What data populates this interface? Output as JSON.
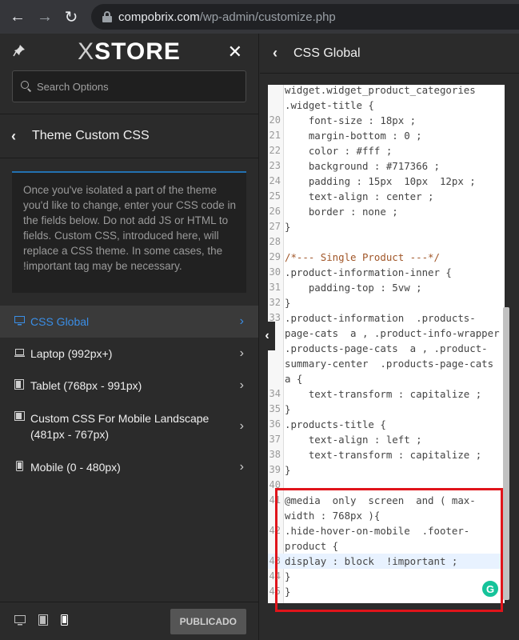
{
  "browser": {
    "url_domain": "compobrix.com",
    "url_path": "/wp-admin/customize.php"
  },
  "sidebar": {
    "logo_x": "X",
    "logo_text": "STORE",
    "search_placeholder": "Search Options",
    "section_title": "Theme Custom CSS",
    "description": "Once you've isolated a part of the theme you'd like to change, enter your CSS code in the fields below. Do not add JS or HTML to fields. Custom CSS, introduced here, will replace a CSS theme. In some cases, the !important tag may be necessary.",
    "items": [
      {
        "label": "CSS Global",
        "icon": "desktop-icon",
        "active": true
      },
      {
        "label": "Laptop (992px+)",
        "icon": "laptop-icon",
        "active": false
      },
      {
        "label": "Tablet (768px - 991px)",
        "icon": "tablet-icon",
        "active": false
      },
      {
        "label": "Custom CSS For Mobile Landscape (481px - 767px)",
        "icon": "tablet-landscape-icon",
        "active": false
      },
      {
        "label": "Mobile (0 - 480px)",
        "icon": "mobile-icon",
        "active": false
      }
    ],
    "publish_label": "PUBLICADO"
  },
  "editor": {
    "title": "CSS Global",
    "lines": [
      {
        "n": "",
        "t": "widget.widget_product_categories"
      },
      {
        "n": "",
        "t": ".widget-title {"
      },
      {
        "n": "20",
        "t": "    font-size : 18px ;"
      },
      {
        "n": "21",
        "t": "    margin-bottom : 0 ;"
      },
      {
        "n": "22",
        "t": "    color : #fff ;"
      },
      {
        "n": "23",
        "t": "    background : #717366 ;"
      },
      {
        "n": "24",
        "t": "    padding : 15px  10px  12px ;"
      },
      {
        "n": "25",
        "t": "    text-align : center ;"
      },
      {
        "n": "26",
        "t": "    border : none ;"
      },
      {
        "n": "27",
        "t": "}"
      },
      {
        "n": "28",
        "t": ""
      },
      {
        "n": "29",
        "t": "/*--- Single Product ---*/"
      },
      {
        "n": "30",
        "t": ".product-information-inner {"
      },
      {
        "n": "31",
        "t": "    padding-top : 5vw ;"
      },
      {
        "n": "32",
        "t": "}"
      },
      {
        "n": "33",
        "t": ".product-information  .products-"
      },
      {
        "n": "",
        "t": "page-cats  a , .product-info-wrapper"
      },
      {
        "n": "",
        "t": ".products-page-cats  a , .product-"
      },
      {
        "n": "",
        "t": "summary-center  .products-page-cats"
      },
      {
        "n": "",
        "t": "a {"
      },
      {
        "n": "34",
        "t": "    text-transform : capitalize ;"
      },
      {
        "n": "35",
        "t": "}"
      },
      {
        "n": "36",
        "t": ".products-title {"
      },
      {
        "n": "37",
        "t": "    text-align : left ;"
      },
      {
        "n": "38",
        "t": "    text-transform : capitalize ;"
      },
      {
        "n": "39",
        "t": "}"
      },
      {
        "n": "40",
        "t": ""
      },
      {
        "n": "41",
        "t": "@media  only  screen  and ( max-"
      },
      {
        "n": "",
        "t": "width : 768px ){"
      },
      {
        "n": "42",
        "t": ".hide-hover-on-mobile  .footer-"
      },
      {
        "n": "",
        "t": "product {"
      },
      {
        "n": "43",
        "t": "display : block  !important ;"
      },
      {
        "n": "44",
        "t": "}"
      },
      {
        "n": "45",
        "t": "}"
      }
    ]
  },
  "badge": "G"
}
